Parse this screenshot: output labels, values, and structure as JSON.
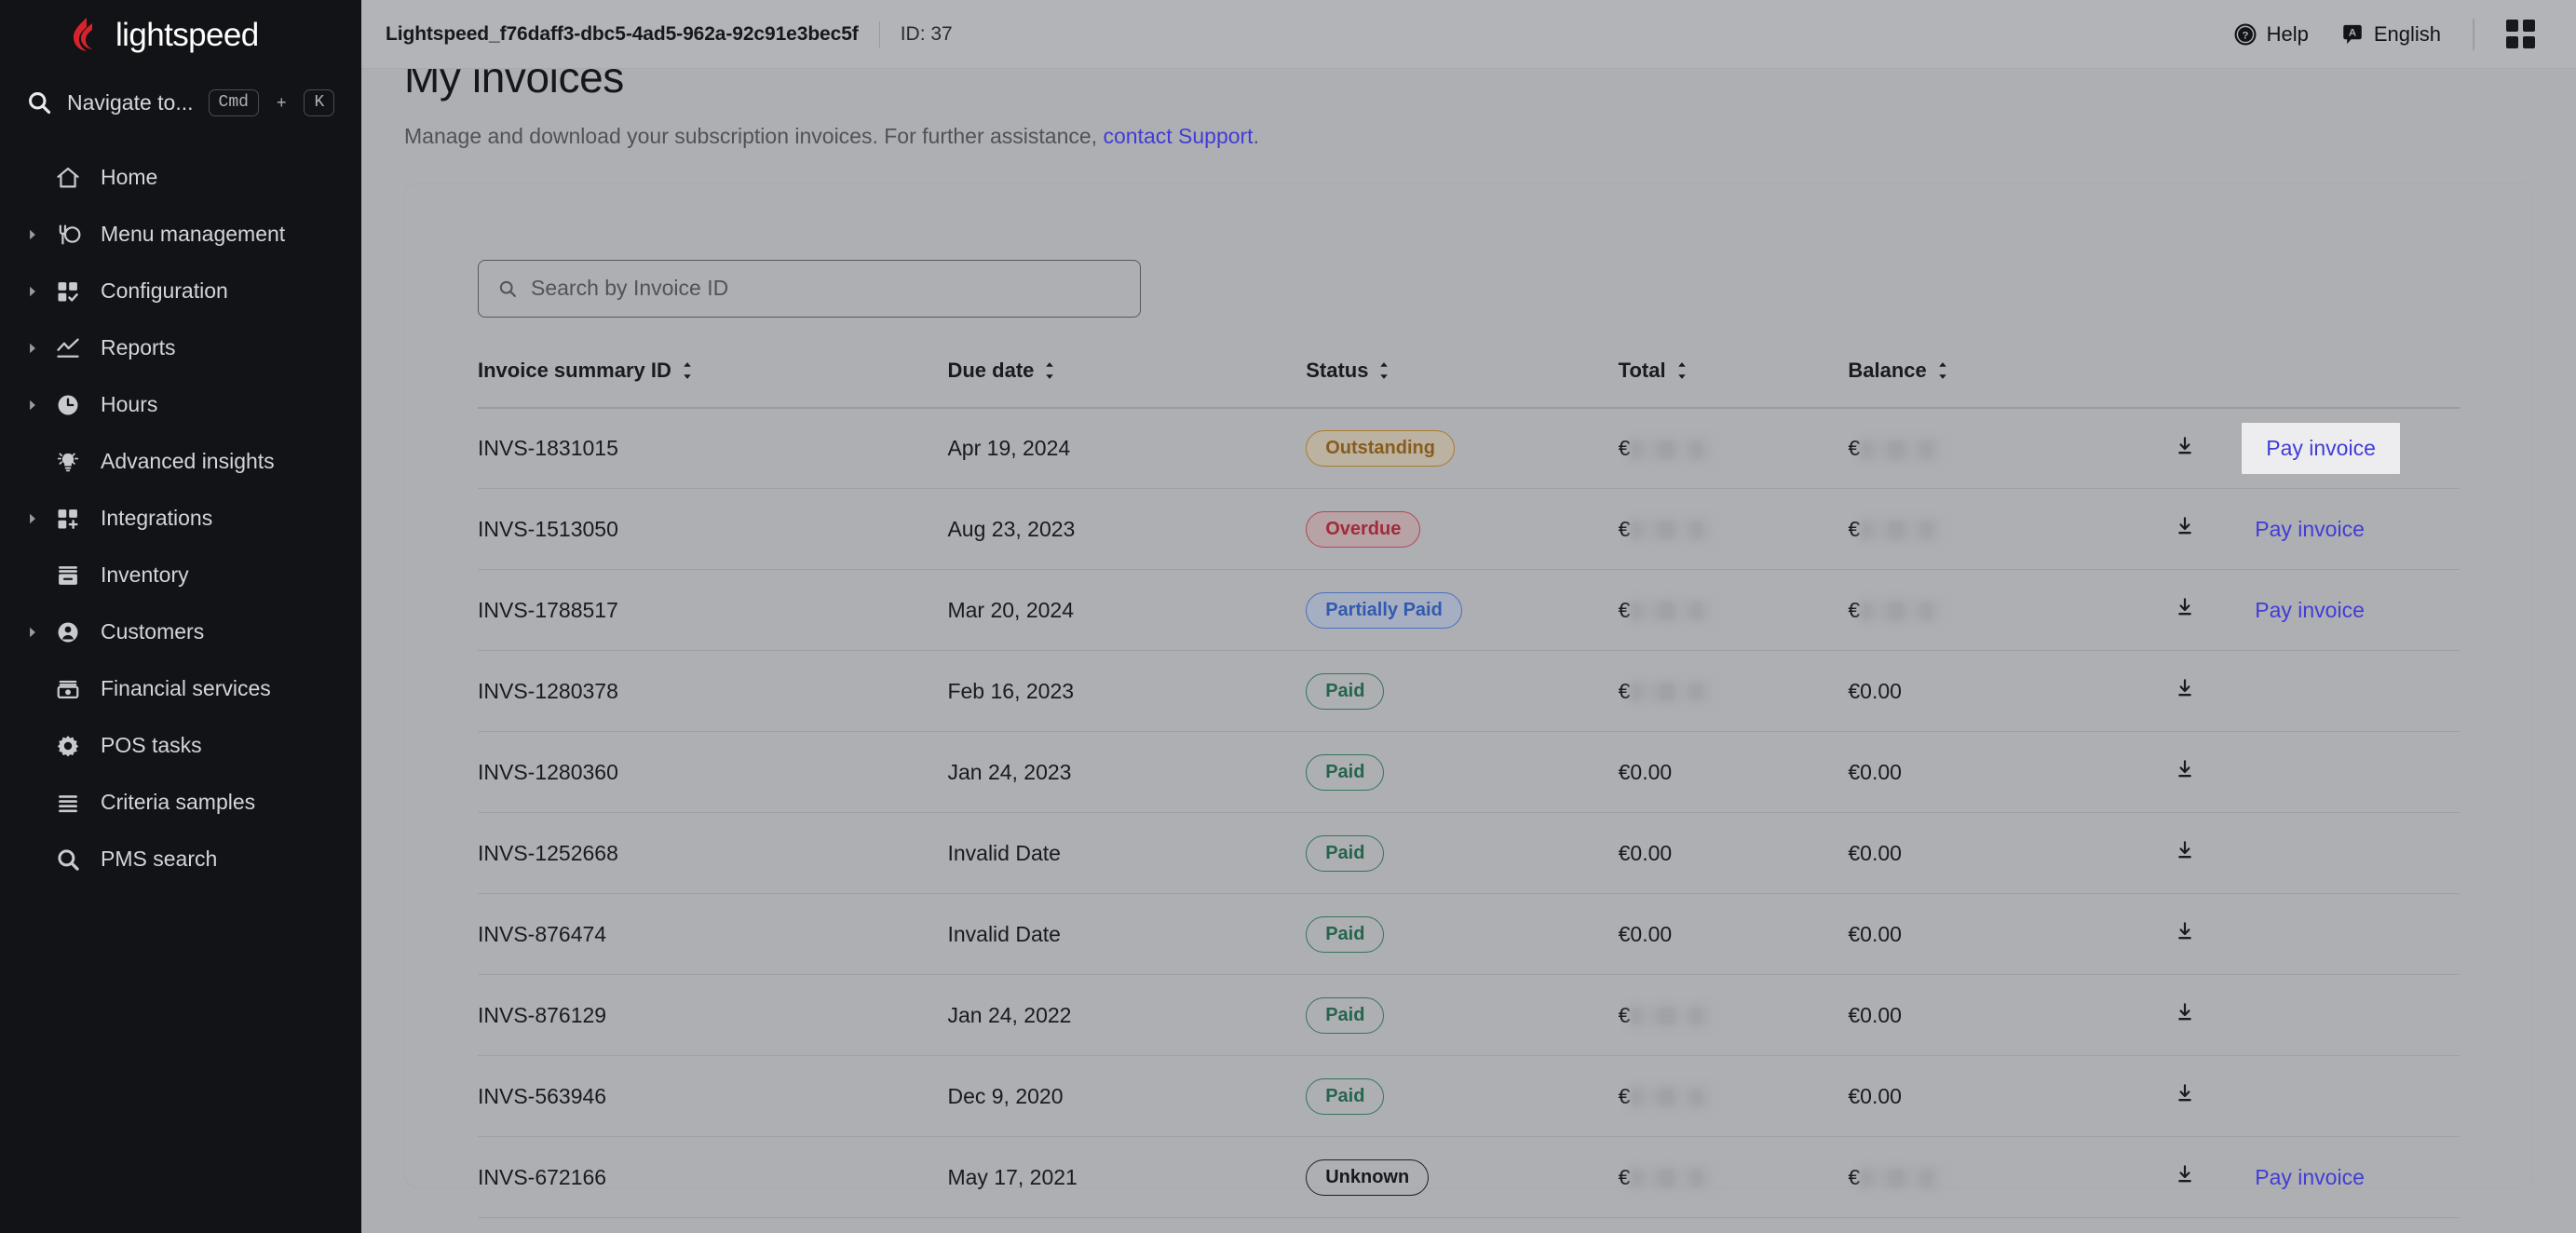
{
  "sidebar": {
    "brand": "lightspeed",
    "search": {
      "label": "Navigate to...",
      "key_mod": "Cmd",
      "key_plus": "+",
      "key_letter": "K"
    },
    "items": [
      {
        "label": "Home",
        "icon": "home-icon",
        "caret": false
      },
      {
        "label": "Menu management",
        "icon": "menu-management-icon",
        "caret": true
      },
      {
        "label": "Configuration",
        "icon": "configuration-icon",
        "caret": true
      },
      {
        "label": "Reports",
        "icon": "reports-icon",
        "caret": true
      },
      {
        "label": "Hours",
        "icon": "clock-icon",
        "caret": true
      },
      {
        "label": "Advanced insights",
        "icon": "lightbulb-icon",
        "caret": false
      },
      {
        "label": "Integrations",
        "icon": "integrations-icon",
        "caret": true
      },
      {
        "label": "Inventory",
        "icon": "inventory-icon",
        "caret": false
      },
      {
        "label": "Customers",
        "icon": "customers-icon",
        "caret": true
      },
      {
        "label": "Financial services",
        "icon": "financial-services-icon",
        "caret": false
      },
      {
        "label": "POS tasks",
        "icon": "gear-icon",
        "caret": false
      },
      {
        "label": "Criteria samples",
        "icon": "list-icon",
        "caret": false
      },
      {
        "label": "PMS search",
        "icon": "search-icon",
        "caret": false
      }
    ]
  },
  "topbar": {
    "tenant_name": "Lightspeed_f76daff3-dbc5-4ad5-962a-92c91e3bec5f",
    "tenant_id": "ID: 37",
    "help_label": "Help",
    "language_label": "English",
    "language_badge": "A",
    "apps_icon": "grid-apps-icon"
  },
  "page": {
    "title": "My invoices",
    "subtitle_before": "Manage and download your subscription invoices. For further assistance, ",
    "subtitle_link": "contact Support",
    "subtitle_after": "."
  },
  "search": {
    "placeholder": "Search by Invoice ID",
    "value": ""
  },
  "table": {
    "columns": [
      {
        "label": "Invoice summary ID",
        "sortable": true
      },
      {
        "label": "Due date",
        "sortable": true
      },
      {
        "label": "Status",
        "sortable": true
      },
      {
        "label": "Total",
        "sortable": true
      },
      {
        "label": "Balance",
        "sortable": true
      },
      {
        "label": "",
        "sortable": false
      },
      {
        "label": "",
        "sortable": false
      }
    ],
    "pay_label": "Pay invoice",
    "currency": "€",
    "rows": [
      {
        "id": "INVS-1831015",
        "due": "Apr 19, 2024",
        "status": "Outstanding",
        "status_kind": "outstanding",
        "total": "redacted",
        "balance": "redacted",
        "download": true,
        "pay": true,
        "pay_focused": true
      },
      {
        "id": "INVS-1513050",
        "due": "Aug 23, 2023",
        "status": "Overdue",
        "status_kind": "overdue",
        "total": "redacted",
        "balance": "redacted",
        "download": true,
        "pay": true,
        "pay_focused": false
      },
      {
        "id": "INVS-1788517",
        "due": "Mar 20, 2024",
        "status": "Partially Paid",
        "status_kind": "partially",
        "total": "redacted",
        "balance": "redacted",
        "download": true,
        "pay": true,
        "pay_focused": false
      },
      {
        "id": "INVS-1280378",
        "due": "Feb 16, 2023",
        "status": "Paid",
        "status_kind": "paid",
        "total": "redacted",
        "balance": "€0.00",
        "download": true,
        "pay": false,
        "pay_focused": false
      },
      {
        "id": "INVS-1280360",
        "due": "Jan 24, 2023",
        "status": "Paid",
        "status_kind": "paid",
        "total": "€0.00",
        "balance": "€0.00",
        "download": true,
        "pay": false,
        "pay_focused": false
      },
      {
        "id": "INVS-1252668",
        "due": "Invalid Date",
        "status": "Paid",
        "status_kind": "paid",
        "total": "€0.00",
        "balance": "€0.00",
        "download": true,
        "pay": false,
        "pay_focused": false
      },
      {
        "id": "INVS-876474",
        "due": "Invalid Date",
        "status": "Paid",
        "status_kind": "paid",
        "total": "€0.00",
        "balance": "€0.00",
        "download": true,
        "pay": false,
        "pay_focused": false
      },
      {
        "id": "INVS-876129",
        "due": "Jan 24, 2022",
        "status": "Paid",
        "status_kind": "paid",
        "total": "redacted",
        "balance": "€0.00",
        "download": true,
        "pay": false,
        "pay_focused": false
      },
      {
        "id": "INVS-563946",
        "due": "Dec 9, 2020",
        "status": "Paid",
        "status_kind": "paid",
        "total": "redacted",
        "balance": "€0.00",
        "download": true,
        "pay": false,
        "pay_focused": false
      },
      {
        "id": "INVS-672166",
        "due": "May 17, 2021",
        "status": "Unknown",
        "status_kind": "unknown",
        "total": "redacted",
        "balance": "redacted",
        "download": true,
        "pay": true,
        "pay_focused": false
      }
    ]
  },
  "colors": {
    "sidebar_bg": "#121316",
    "brand_red": "#d6242c",
    "link_blue": "#3b36e0",
    "paid_green": "#1d6347",
    "overdue_red": "#a52433",
    "outstanding_amber": "#8a5a12",
    "partial_blue": "#2b57b5"
  }
}
